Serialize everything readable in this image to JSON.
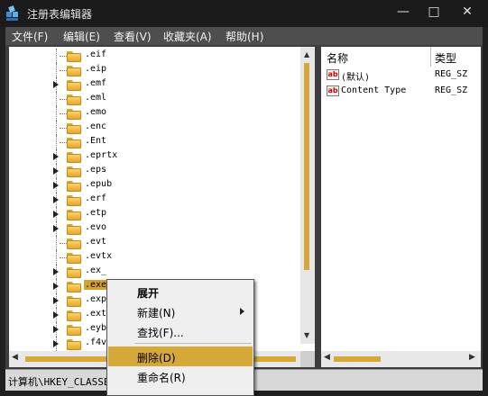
{
  "window": {
    "title": "注册表编辑器",
    "minimize_glyph": "—",
    "maximize_glyph": "□",
    "close_glyph": "✕"
  },
  "menubar": {
    "items": [
      "文件(F)",
      "编辑(E)",
      "查看(V)",
      "收藏夹(A)",
      "帮助(H)"
    ]
  },
  "tree": {
    "items": [
      {
        "label": ".eif",
        "expandable": false,
        "selected": false
      },
      {
        "label": ".eip",
        "expandable": false,
        "selected": false
      },
      {
        "label": ".emf",
        "expandable": true,
        "selected": false
      },
      {
        "label": ".eml",
        "expandable": false,
        "selected": false
      },
      {
        "label": ".emo",
        "expandable": false,
        "selected": false
      },
      {
        "label": ".enc",
        "expandable": false,
        "selected": false
      },
      {
        "label": ".Ent",
        "expandable": false,
        "selected": false
      },
      {
        "label": ".eprtx",
        "expandable": true,
        "selected": false
      },
      {
        "label": ".eps",
        "expandable": true,
        "selected": false
      },
      {
        "label": ".epub",
        "expandable": true,
        "selected": false
      },
      {
        "label": ".erf",
        "expandable": true,
        "selected": false
      },
      {
        "label": ".etp",
        "expandable": true,
        "selected": false
      },
      {
        "label": ".evo",
        "expandable": true,
        "selected": false
      },
      {
        "label": ".evt",
        "expandable": false,
        "selected": false
      },
      {
        "label": ".evtx",
        "expandable": false,
        "selected": false
      },
      {
        "label": ".ex_",
        "expandable": true,
        "selected": false
      },
      {
        "label": ".exe",
        "expandable": true,
        "selected": true
      },
      {
        "label": ".exp",
        "expandable": true,
        "selected": false
      },
      {
        "label": ".ext",
        "expandable": true,
        "selected": false
      },
      {
        "label": ".eyb",
        "expandable": true,
        "selected": false
      },
      {
        "label": ".f4v",
        "expandable": true,
        "selected": false
      }
    ]
  },
  "values": {
    "headers": {
      "name": "名称",
      "type": "类型"
    },
    "rows": [
      {
        "name": "(默认)",
        "type": "REG_SZ",
        "icon": "ab-string-icon"
      },
      {
        "name": "Content Type",
        "type": "REG_SZ",
        "icon": "ab-string-icon"
      }
    ]
  },
  "statusbar": {
    "path": "计算机\\HKEY_CLASSE"
  },
  "context_menu": {
    "items": [
      {
        "label": "展开",
        "bold": true,
        "submenu": false,
        "hover": false
      },
      {
        "label": "新建(N)",
        "bold": false,
        "submenu": true,
        "hover": false
      },
      {
        "label": "查找(F)...",
        "bold": false,
        "submenu": false,
        "hover": false
      },
      {
        "label": "删除(D)",
        "bold": false,
        "submenu": false,
        "hover": true
      },
      {
        "label": "重命名(R)",
        "bold": false,
        "submenu": false,
        "hover": false
      }
    ]
  },
  "colors": {
    "accent": "#d6a838",
    "titlebar": "#1b1b1b",
    "menubar": "#4e4e4e"
  }
}
